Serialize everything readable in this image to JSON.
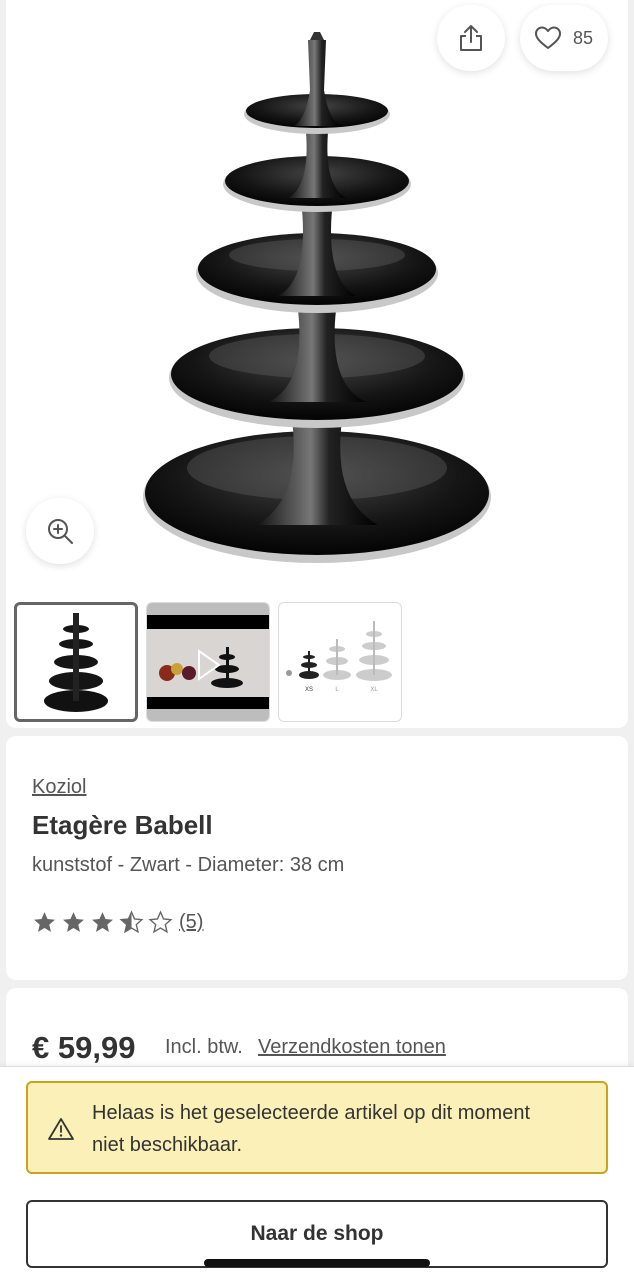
{
  "gallery": {
    "favorite_count": "85",
    "icons": {
      "share": "share-icon",
      "favorite": "heart-icon",
      "zoom": "zoom-in-icon"
    },
    "thumbnails": [
      {
        "label": "product-photo",
        "selected": true
      },
      {
        "label": "product-video",
        "selected": false
      },
      {
        "label": "size-overview",
        "selected": false,
        "size_labels": [
          "XS",
          "L",
          "XL"
        ]
      }
    ]
  },
  "product": {
    "brand": "Koziol",
    "title": "Etagère Babell",
    "subtitle": "kunststof - Zwart - Diameter: 38 cm",
    "rating": 3.5,
    "rating_max": 5,
    "review_count": "(5)"
  },
  "pricing": {
    "price": "€ 59,99",
    "vat_note": "Incl. btw.",
    "shipping_link": "Verzendkosten tonen"
  },
  "notice": {
    "icon": "warning-icon",
    "text": "Helaas is het geselecteerde artikel op dit moment niet beschikbaar."
  },
  "actions": {
    "shop_button": "Naar de shop"
  },
  "colors": {
    "notice_background": "#fbf0b8",
    "notice_border": "#c9a31e",
    "text_primary": "#333333"
  }
}
